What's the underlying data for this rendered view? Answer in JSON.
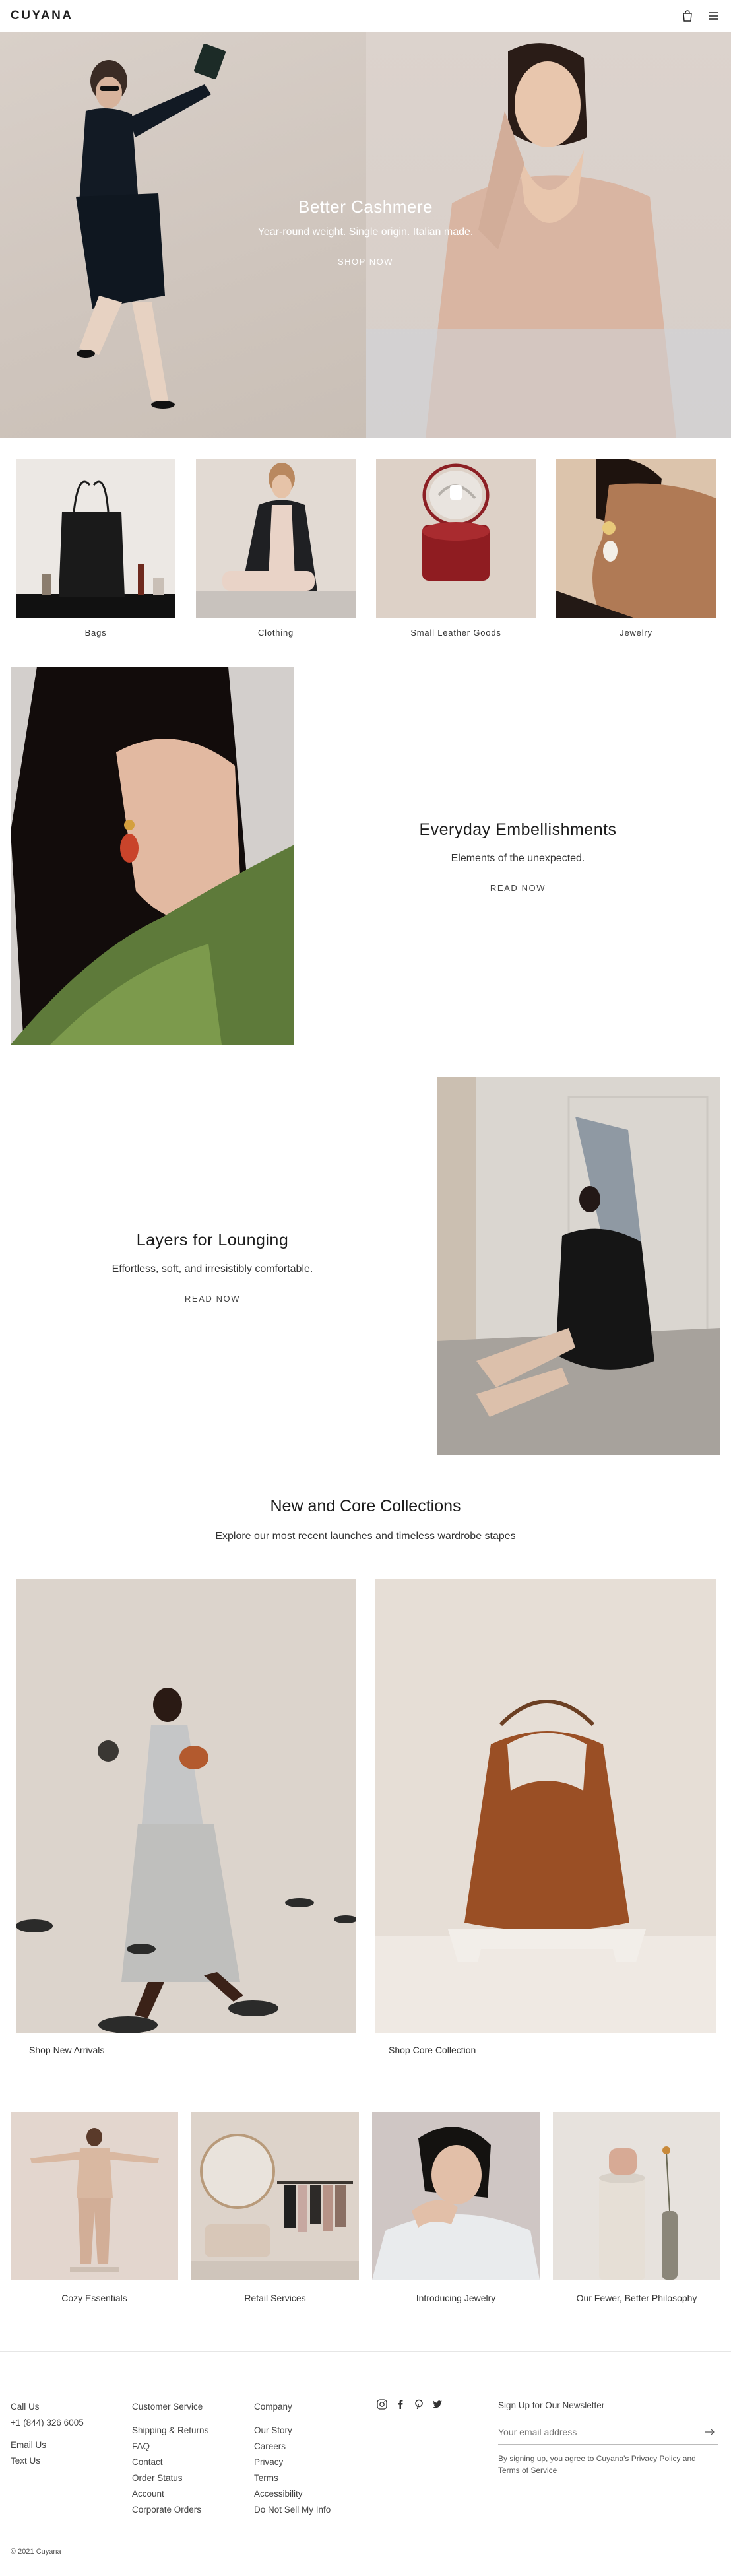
{
  "header": {
    "logo": "CUYANA",
    "bag_icon": "shopping-bag-icon",
    "menu_icon": "hamburger-menu-icon"
  },
  "hero": {
    "title": "Better Cashmere",
    "subtitle": "Year-round weight. Single origin. Italian made.",
    "cta": "SHOP NOW"
  },
  "categories": [
    {
      "label": "Bags"
    },
    {
      "label": "Clothing"
    },
    {
      "label": "Small Leather Goods"
    },
    {
      "label": "Jewelry"
    }
  ],
  "editorial_1": {
    "title": "Everyday Embellishments",
    "subtitle": "Elements of the unexpected.",
    "cta": "READ NOW"
  },
  "editorial_2": {
    "title": "Layers for Lounging",
    "subtitle": "Effortless, soft, and irresistibly comfortable.",
    "cta": "READ NOW"
  },
  "collections": {
    "title": "New and Core Collections",
    "subtitle": "Explore our most recent launches and timeless wardrobe stapes",
    "items": [
      {
        "label": "Shop New Arrivals"
      },
      {
        "label": "Shop Core Collection"
      }
    ]
  },
  "services": [
    {
      "label": "Cozy Essentials"
    },
    {
      "label": "Retail Services"
    },
    {
      "label": "Introducing Jewelry"
    },
    {
      "label": "Our Fewer, Better Philosophy"
    }
  ],
  "footer": {
    "contact": {
      "call_label": "Call Us",
      "phone": "+1 (844) 326 6005",
      "email": "Email Us",
      "text": "Text Us"
    },
    "customer_service": {
      "heading": "Customer Service",
      "links": [
        "Shipping & Returns",
        "FAQ",
        "Contact",
        "Order Status",
        "Account",
        "Corporate Orders"
      ]
    },
    "company": {
      "heading": "Company",
      "links": [
        "Our Story",
        "Careers",
        "Privacy",
        "Terms",
        "Accessibility",
        "Do Not Sell My Info"
      ]
    },
    "social_icons": [
      "instagram-icon",
      "facebook-icon",
      "pinterest-icon",
      "twitter-icon"
    ],
    "newsletter": {
      "heading": "Sign Up for Our Newsletter",
      "placeholder": "Your email address",
      "legal_prefix": "By signing up, you agree to Cuyana's",
      "privacy_link": "Privacy Policy",
      "legal_and": "and",
      "terms_link": "Terms of Service"
    },
    "copyright": "© 2021 Cuyana"
  },
  "colors": {
    "text": "#1f1f1f",
    "hero_bg": "#d6ccc5",
    "rule": "#e6e6e6"
  }
}
